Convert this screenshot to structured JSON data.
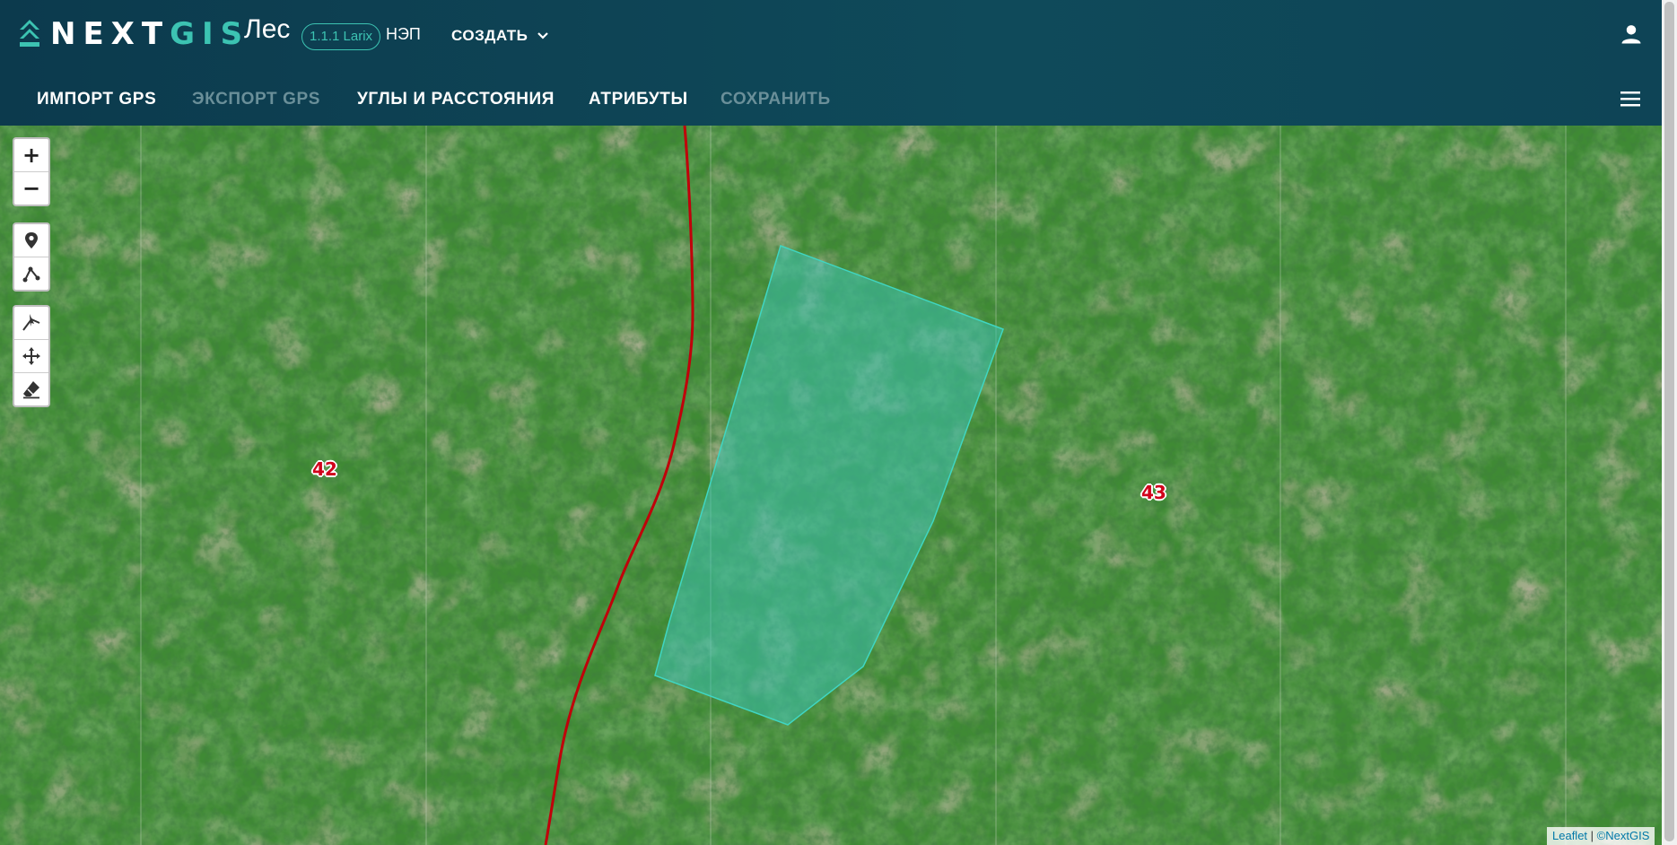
{
  "header": {
    "logo_next": "NEXT",
    "logo_gis": "GIS",
    "app_name": "Лес",
    "version": "1.1.1 Larix",
    "nep": "НЭП",
    "create_label": "СОЗДАТЬ"
  },
  "toolbar": {
    "items": [
      {
        "label": "ИМПОРТ GPS",
        "enabled": true
      },
      {
        "label": "ЭКСПОРТ GPS",
        "enabled": false
      },
      {
        "label": "УГЛЫ И РАССТОЯНИЯ",
        "enabled": true
      },
      {
        "label": "АТРИБУТЫ",
        "enabled": true
      },
      {
        "label": "СОХРАНИТЬ",
        "enabled": false
      }
    ]
  },
  "map": {
    "zoom_in": "+",
    "zoom_out": "−",
    "quarter_labels": [
      "42",
      "43"
    ],
    "attribution_leaflet": "Leaflet",
    "attribution_sep": " | ",
    "attribution_nextgis": "©NextGIS"
  },
  "colors": {
    "header_bg": "#0e4456",
    "accent": "#3cc3b2",
    "polygon_fill": "#3cc3b2",
    "road": "#c0000a",
    "label": "#d0021b"
  },
  "icons": [
    "user-icon",
    "menu-icon",
    "marker-icon",
    "polyline-icon",
    "edit-vertex-icon",
    "move-icon",
    "eraser-icon",
    "chevron-down-icon"
  ]
}
